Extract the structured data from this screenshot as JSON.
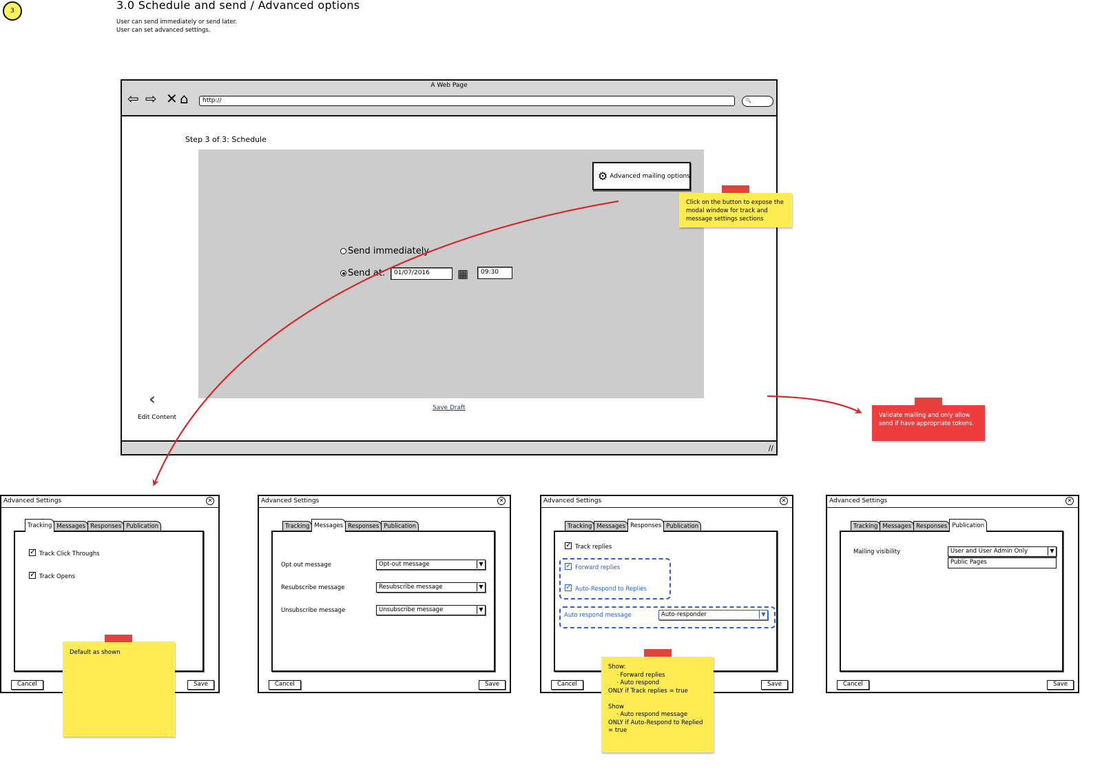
{
  "header": {
    "step_number": "3",
    "title": "3.0 Schedule and send / Advanced options",
    "desc_line1": "User can send immediately or send later.",
    "desc_line2": "User can set advanced settings."
  },
  "browser": {
    "window_title": "A Web Page",
    "url": "http://",
    "search_glyph": "🔍"
  },
  "schedule": {
    "step_title": "Step 3 of 3: Schedule",
    "advanced_button": "Advanced mailing options",
    "send_immediately": "Send immediately",
    "send_at": "Send at:",
    "date_value": "01/07/2016",
    "time_value": "09:30",
    "edit_content": "Edit Content",
    "save_draft": "Save Draft"
  },
  "notes": {
    "advanced_hint": [
      "Click on the button to expose the",
      "modal window for track and",
      "message settings sections"
    ],
    "validate_hint": [
      "Validate mailing and only allow",
      "send if have appropriate tokens."
    ],
    "default_hint": "Default as shown",
    "responses_hint": [
      "Show:",
      "·    Forward replies",
      "·    Auto respond",
      "ONLY if Track replies = true",
      "",
      "Show",
      "·    Auto respond message",
      "ONLY if Auto-Respond to Replied",
      "= true"
    ]
  },
  "dialogs": {
    "title": "Advanced Settings",
    "close_glyph": "✕",
    "tabs": [
      "Tracking",
      "Messages",
      "Responses",
      "Publication"
    ],
    "cancel": "Cancel",
    "save": "Save",
    "tracking": {
      "track_click_throughs": "Track Click Throughs",
      "track_opens": "Track Opens"
    },
    "messages": {
      "opt_out_label": "Opt out message",
      "opt_out_value": "Opt-out message",
      "resubscribe_label": "Resubscribe message",
      "resubscribe_value": "Resubscribe message",
      "unsubscribe_label": "Unsubscribe message",
      "unsubscribe_value": "Unsubscribe message"
    },
    "responses": {
      "track_replies": "Track replies",
      "forward_replies": "Forward replies",
      "auto_respond": "Auto-Respond to Replies",
      "auto_respond_message_label": "Auto respond message",
      "auto_respond_message_value": "Auto-responder"
    },
    "publication": {
      "visibility_label": "Mailing visibility",
      "visibility_value": "User and User Admin Only",
      "visibility_option": "Public Pages"
    }
  },
  "colors": {
    "sticky_yellow": "#ffeb52",
    "sticky_red": "#ef3d3d",
    "arrow_red": "#d42a2a",
    "link_blue": "#17389a",
    "conditional_blue": "#2563d6",
    "panel_gray": "#cccccc"
  }
}
